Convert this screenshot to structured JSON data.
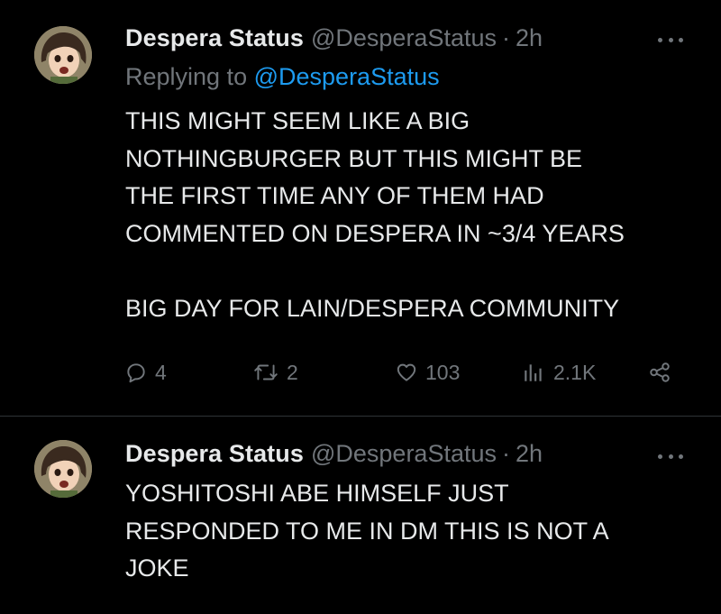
{
  "tweets": [
    {
      "author": {
        "display_name": "Despera Status",
        "handle": "@DesperaStatus",
        "separator": "·",
        "time": "2h",
        "avatar_icon": "anime-avatar-icon"
      },
      "replying": {
        "prefix": "Replying to",
        "mention": "@DesperaStatus"
      },
      "text": "THIS MIGHT SEEM LIKE A BIG\nNOTHINGBURGER BUT THIS MIGHT BE\nTHE FIRST TIME ANY OF THEM HAD\nCOMMENTED ON DESPERA IN ~3/4 YEARS\n\nBIG DAY FOR LAIN/DESPERA COMMUNITY",
      "stats": {
        "replies": "4",
        "retweets": "2",
        "likes": "103",
        "views": "2.1K"
      }
    },
    {
      "author": {
        "display_name": "Despera Status",
        "handle": "@DesperaStatus",
        "separator": "·",
        "time": "2h",
        "avatar_icon": "anime-avatar-icon"
      },
      "text": "YOSHITOSHI ABE HIMSELF JUST\nRESPONDED TO ME IN DM THIS IS NOT A\nJOKE"
    }
  ],
  "colors": {
    "background": "#000000",
    "text": "#e7e9ea",
    "secondary": "#71767b",
    "link": "#1d9bf0",
    "divider": "#2f3336"
  },
  "icons": [
    "more-icon",
    "reply-icon",
    "retweet-icon",
    "like-icon",
    "views-icon",
    "share-icon"
  ]
}
